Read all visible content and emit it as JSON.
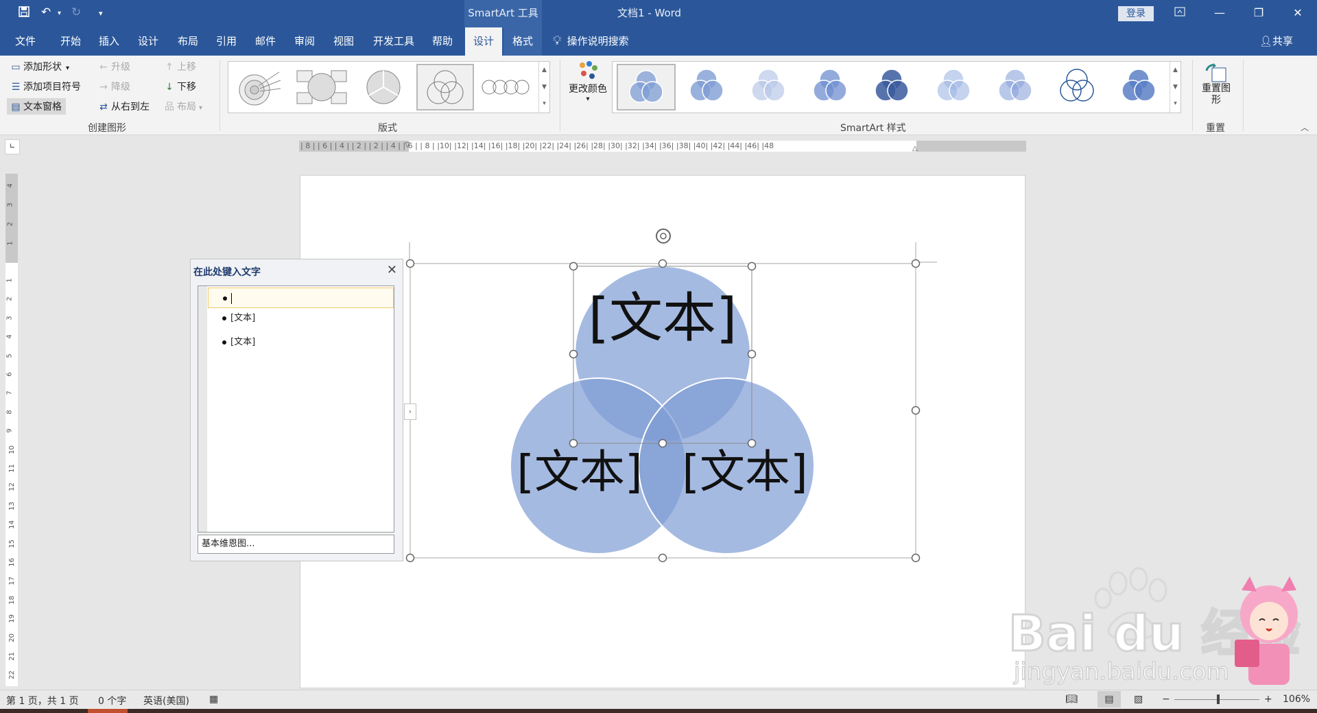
{
  "title_bar": {
    "context_tab": "SmartArt 工具",
    "doc_title": "文档1  -  Word",
    "login_label": "登录"
  },
  "tabs": [
    {
      "label": "文件"
    },
    {
      "label": "开始"
    },
    {
      "label": "插入"
    },
    {
      "label": "设计"
    },
    {
      "label": "布局"
    },
    {
      "label": "引用"
    },
    {
      "label": "邮件"
    },
    {
      "label": "审阅"
    },
    {
      "label": "视图"
    },
    {
      "label": "开发工具"
    },
    {
      "label": "帮助"
    },
    {
      "label": "设计"
    },
    {
      "label": "格式"
    }
  ],
  "tell_me": "操作说明搜索",
  "share": "共享",
  "ribbon": {
    "create": {
      "add_shape": "添加形状",
      "add_bullet": "添加项目符号",
      "text_pane": "文本窗格",
      "promote": "升级",
      "demote": "降级",
      "rtl": "从右到左",
      "move_up": "上移",
      "move_down": "下移",
      "layout": "布局",
      "group_label": "创建图形"
    },
    "layouts_group_label": "版式",
    "change_colors": "更改颜色",
    "styles_group_label": "SmartArt 样式",
    "reset_graphic": "重置图形",
    "reset_group_label": "重置"
  },
  "ruler": {
    "h_text": "| 8 |   | 6 |   | 4 |   | 2 |       | 2 |   | 4 |   | 6 |   | 8 |   |10|   |12|   |14|   |16|   |18|   |20|   |22|   |24|   |26|   |28|   |30|   |32|   |34|   |36|   |38|   |40|   |42|   |44|   |46|   |48",
    "v_top": [
      "4",
      "3",
      "2",
      "1"
    ],
    "v_main": [
      "1",
      "2",
      "3",
      "4",
      "5",
      "6",
      "7",
      "8",
      "9",
      "10",
      "11",
      "12",
      "13",
      "14",
      "15",
      "16",
      "17",
      "18",
      "19",
      "20",
      "21",
      "22"
    ]
  },
  "text_pane": {
    "title": "在此处键入文字",
    "items": [
      "",
      "[文本]",
      "[文本]"
    ],
    "footer": "基本维恩图..."
  },
  "venn": {
    "labels": [
      "[文本]",
      "[文本]",
      "[文本]"
    ],
    "fill_color": "#7f9dd4",
    "overlap_color": "#5b7fc6"
  },
  "status": {
    "page": "第 1 页，共 1 页",
    "words": "0 个字",
    "language": "英语(美国)",
    "zoom": "106%"
  },
  "watermark": {
    "text": "Bai du 经验",
    "url": "jingyan.baidu.com"
  },
  "colors": {
    "brand_blue": "#2b579a",
    "ribbon_bg": "#f3f3f3"
  }
}
